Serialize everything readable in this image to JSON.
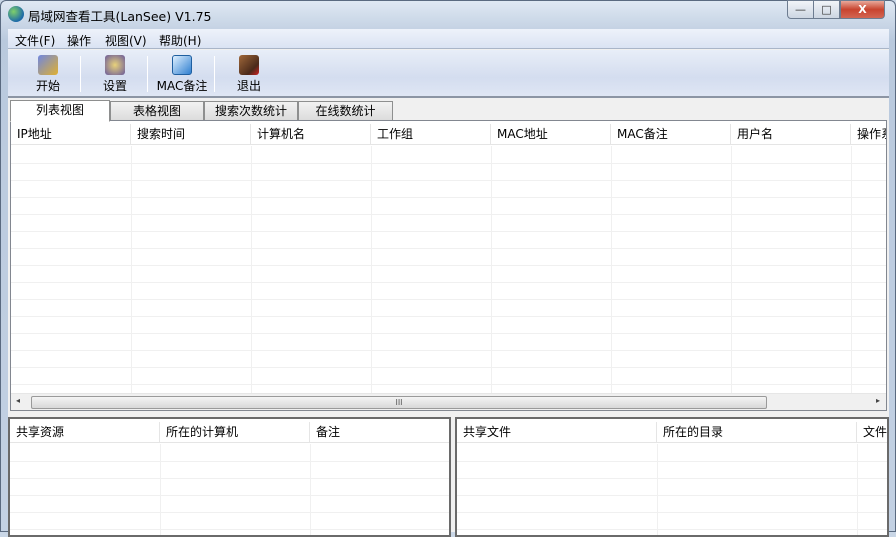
{
  "window": {
    "title": "局域网查看工具(LanSee) V1.75",
    "minimize": "—",
    "maximize": "□",
    "close": "X"
  },
  "menu": [
    "文件(F)",
    "操作",
    "视图(V)",
    "帮助(H)"
  ],
  "toolbar": [
    {
      "label": "开始",
      "icon": "start-icon",
      "color": "#4a62c8"
    },
    {
      "label": "设置",
      "icon": "settings-icon",
      "color": "#7a6a9e"
    },
    {
      "label": "MAC备注",
      "icon": "mac-note-icon",
      "color": "#2f7fd0"
    },
    {
      "label": "退出",
      "icon": "exit-icon",
      "color": "#7a4a2a"
    }
  ],
  "tabs": [
    "列表视图",
    "表格视图",
    "搜索次数统计",
    "在线数统计"
  ],
  "main_list": {
    "columns": [
      "IP地址",
      "搜索时间",
      "计算机名",
      "工作组",
      "MAC地址",
      "MAC备注",
      "用户名",
      "操作系统"
    ]
  },
  "share_list": {
    "columns": [
      "共享资源",
      "所在的计算机",
      "备注"
    ]
  },
  "file_list": {
    "columns": [
      "共享文件",
      "所在的目录",
      "文件"
    ]
  },
  "scrollbar": {
    "grip": "III",
    "left": "◂",
    "right": "▸"
  }
}
